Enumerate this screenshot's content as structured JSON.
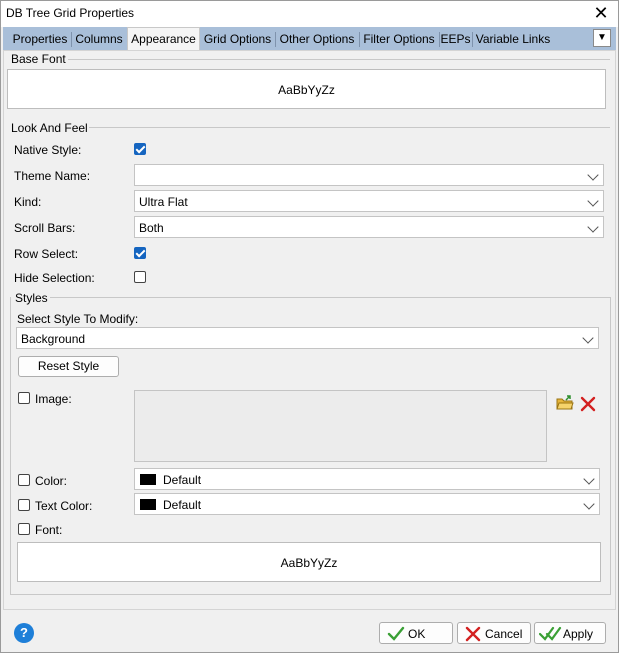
{
  "window": {
    "title": "DB Tree Grid Properties"
  },
  "tabs": [
    {
      "label": "Properties"
    },
    {
      "label": "Columns"
    },
    {
      "label": "Appearance"
    },
    {
      "label": "Grid Options"
    },
    {
      "label": "Other Options"
    },
    {
      "label": "Filter Options"
    },
    {
      "label": "EEPs"
    },
    {
      "label": "Variable Links"
    }
  ],
  "active_tab": "Appearance",
  "base_font": {
    "title": "Base Font",
    "sample": "AaBbYyZz"
  },
  "look_and_feel": {
    "title": "Look And Feel",
    "native_style": {
      "label": "Native Style:",
      "checked": true
    },
    "theme_name": {
      "label": "Theme Name:",
      "value": ""
    },
    "kind": {
      "label": "Kind:",
      "value": "Ultra Flat"
    },
    "scroll_bars": {
      "label": "Scroll Bars:",
      "value": "Both"
    },
    "row_select": {
      "label": "Row Select:",
      "checked": true
    },
    "hide_selection": {
      "label": "Hide Selection:",
      "checked": false
    }
  },
  "styles": {
    "title": "Styles",
    "select_label": "Select Style To Modify:",
    "selected_style": "Background",
    "reset_label": "Reset Style",
    "image": {
      "label": "Image:",
      "checked": false
    },
    "color": {
      "label": "Color:",
      "checked": false,
      "value": "Default",
      "swatch": "#000000"
    },
    "text_color": {
      "label": "Text Color:",
      "checked": false,
      "value": "Default",
      "swatch": "#000000"
    },
    "font": {
      "label": "Font:",
      "checked": false,
      "sample": "AaBbYyZz"
    }
  },
  "buttons": {
    "ok": "OK",
    "cancel": "Cancel",
    "apply": "Apply"
  },
  "colors": {
    "tab_strip": "#a9bfd9",
    "checkbox_on": "#1565c0",
    "ok_check": "#3aa035",
    "cancel_x": "#d32020",
    "help": "#1e7fd8"
  }
}
